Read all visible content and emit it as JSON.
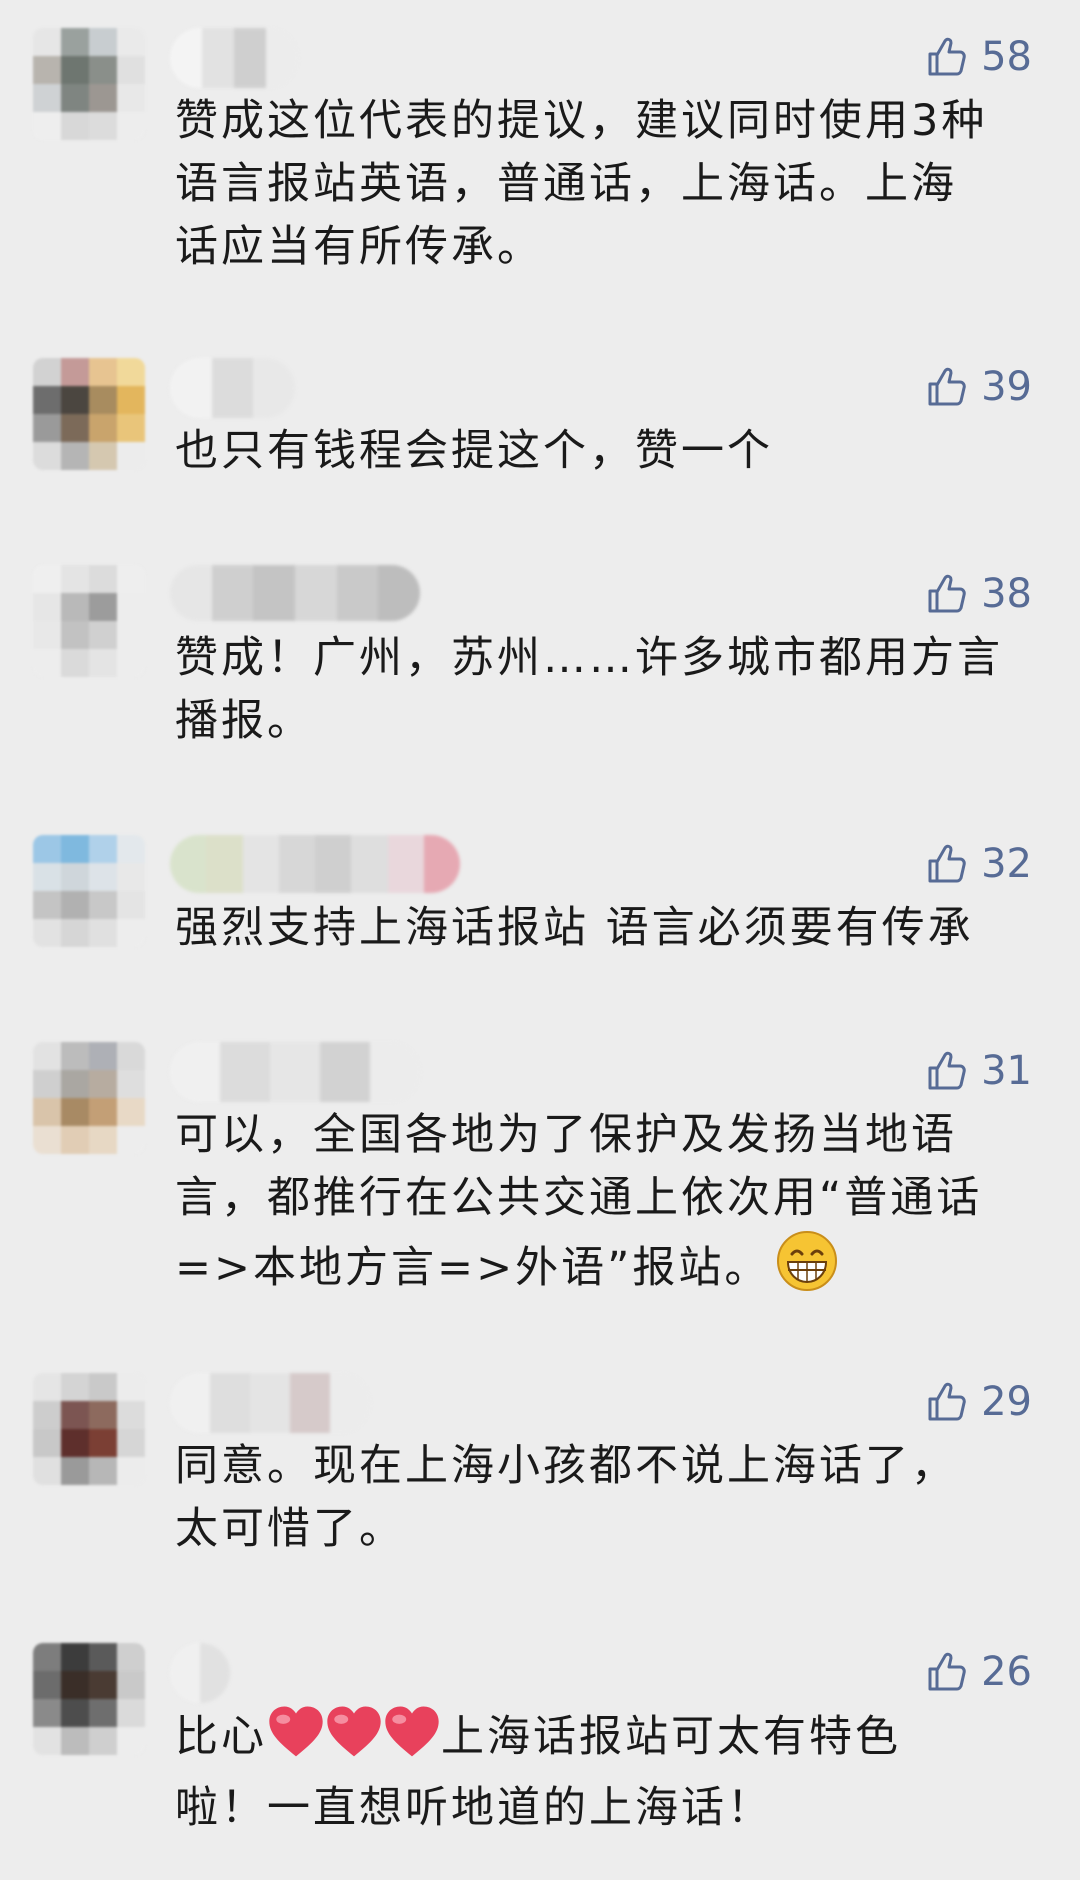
{
  "comments": [
    {
      "likes": "58",
      "text": "赞成这位代表的提议，建议同时使用3种\n语言报站英语，普通话，上海话。上海\n话应当有所传承。"
    },
    {
      "likes": "39",
      "text": "也只有钱程会提这个，赞一个"
    },
    {
      "likes": "38",
      "text": "赞成！广州，苏州……许多城市都用方言\n播报。"
    },
    {
      "likes": "32",
      "text": "强烈支持上海话报站 语言必须要有传承"
    },
    {
      "likes": "31",
      "text": "可以，全国各地为了保护及发扬当地语\n言，都推行在公共交通上依次用“普通话\n=>本地方言=>外语”报站。"
    },
    {
      "likes": "29",
      "text": "同意。现在上海小孩都不说上海话了，\n太可惜了。"
    },
    {
      "likes": "26",
      "text_prefix": "比心",
      "text_suffix": "上海话报站可太有特色\n啦！一直想听地道的上海话！"
    }
  ],
  "colors": {
    "background": "#ededed",
    "like": "#576b95",
    "text": "#1a1a1a"
  },
  "icons": {
    "like": "thumbs-up-icon",
    "emoji": "grin-emoji-icon",
    "heart": "heart-emoji-icon"
  }
}
